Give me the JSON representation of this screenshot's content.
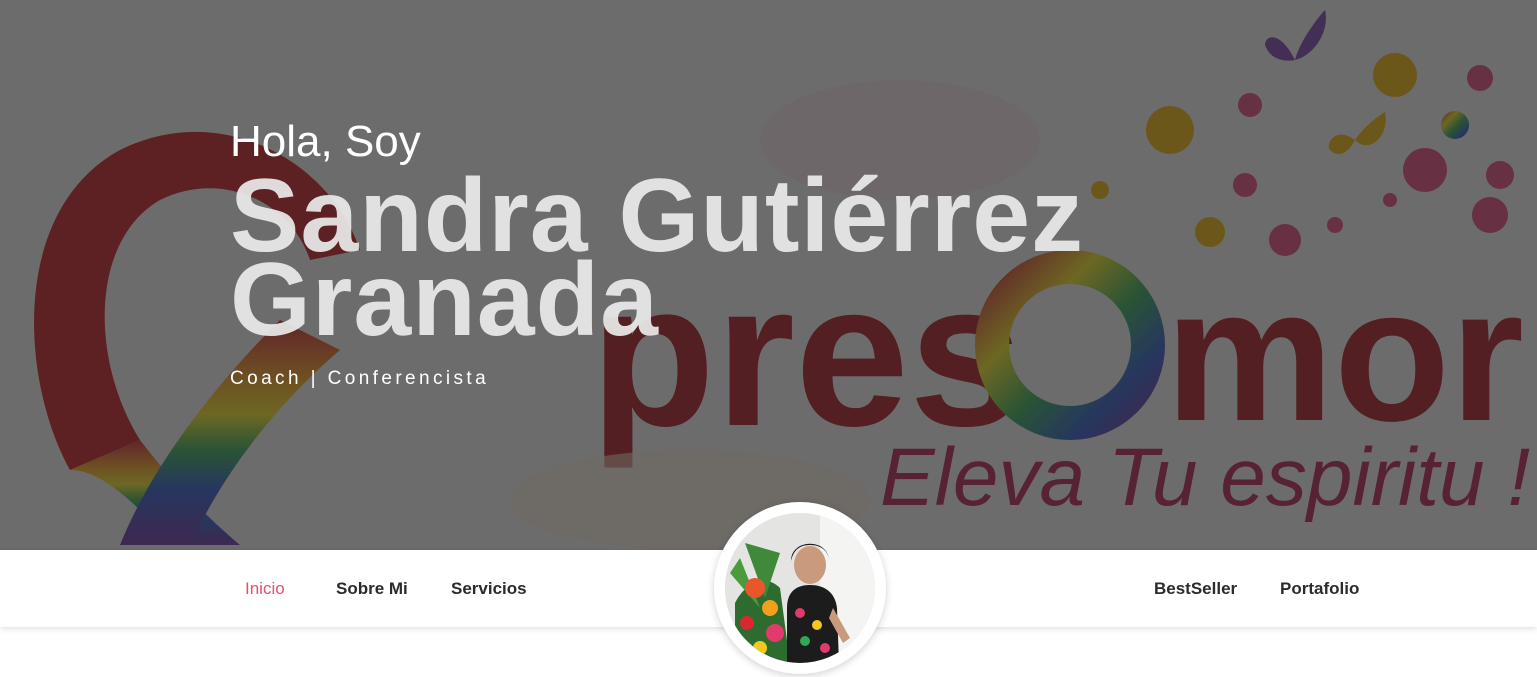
{
  "hero": {
    "greeting": "Hola, Soy",
    "name_line1": "Sandra Gutiérrez",
    "name_line2": "Granada",
    "subtitle": "Coach | Conferencista",
    "background_logo_text": "Expres@mor",
    "background_tagline": "Eleva Tu espiritu !"
  },
  "nav": {
    "left": [
      {
        "label": "Inicio",
        "active": true
      },
      {
        "label": "Sobre Mi",
        "active": false
      },
      {
        "label": "Servicios",
        "active": false
      }
    ],
    "right": [
      {
        "label": "BestSeller",
        "active": false
      },
      {
        "label": "Portafolio",
        "active": false
      }
    ]
  },
  "colors": {
    "accent": "#e2506b",
    "nav_text": "#2b2b2b",
    "hero_overlay": "#282828"
  },
  "icons": {
    "avatar": "profile-photo"
  }
}
